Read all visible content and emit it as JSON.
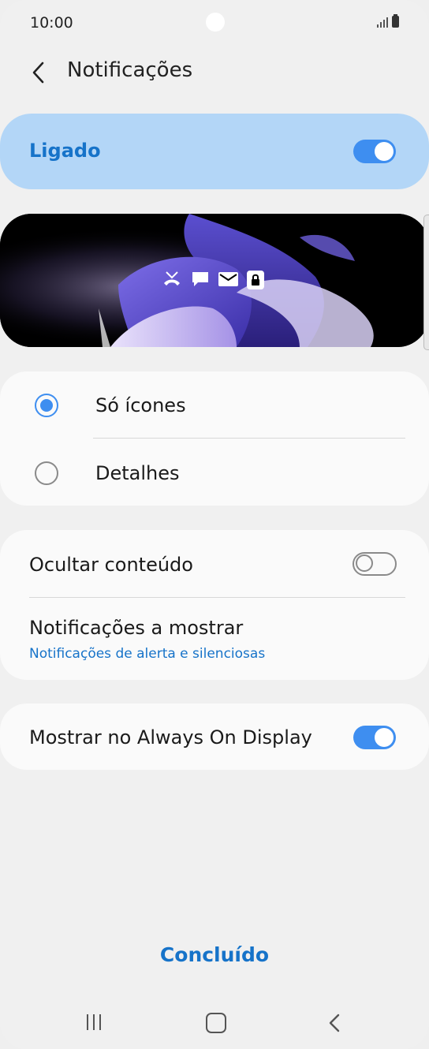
{
  "status_bar": {
    "time": "10:00"
  },
  "header": {
    "title": "Notificações"
  },
  "master": {
    "label": "Ligado",
    "enabled": true
  },
  "style_options": [
    {
      "label": "Só ícones",
      "selected": true
    },
    {
      "label": "Detalhes",
      "selected": false
    }
  ],
  "settings": {
    "hide_content": {
      "label": "Ocultar conteúdo",
      "enabled": false
    },
    "notifications_to_show": {
      "label": "Notificações a mostrar",
      "value": "Notificações de alerta e silenciosas"
    },
    "show_on_aod": {
      "label": "Mostrar no Always On Display",
      "enabled": true
    }
  },
  "footer": {
    "done_label": "Concluído"
  },
  "preview_icons": [
    "missed-call-icon",
    "message-icon",
    "email-icon",
    "lock-icon"
  ],
  "colors": {
    "accent": "#3e8ef0",
    "accent_text": "#1673c9",
    "master_bg": "#b3d6f7",
    "background": "#f0f0f0"
  }
}
